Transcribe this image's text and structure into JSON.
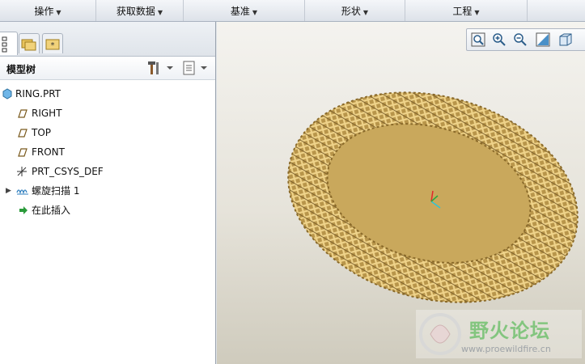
{
  "ribbon": {
    "groups": [
      {
        "label": "操作"
      },
      {
        "label": "获取数据"
      },
      {
        "label": "基准"
      },
      {
        "label": "形状"
      },
      {
        "label": "工程"
      }
    ]
  },
  "model_tree": {
    "title": "模型树",
    "items": [
      {
        "label": "RING.PRT",
        "icon": "part-icon"
      },
      {
        "label": "RIGHT",
        "icon": "datum-plane-icon"
      },
      {
        "label": "TOP",
        "icon": "datum-plane-icon"
      },
      {
        "label": "FRONT",
        "icon": "datum-plane-icon"
      },
      {
        "label": "PRT_CSYS_DEF",
        "icon": "csys-icon"
      },
      {
        "label": "螺旋扫描 1",
        "icon": "helical-sweep-icon"
      },
      {
        "label": "在此插入",
        "icon": "insert-here-arrow-icon"
      }
    ]
  },
  "viewport": {
    "model_color": "#c9a85c"
  },
  "watermark": {
    "title": "野火论坛",
    "url": "www.proewildfire.cn"
  }
}
